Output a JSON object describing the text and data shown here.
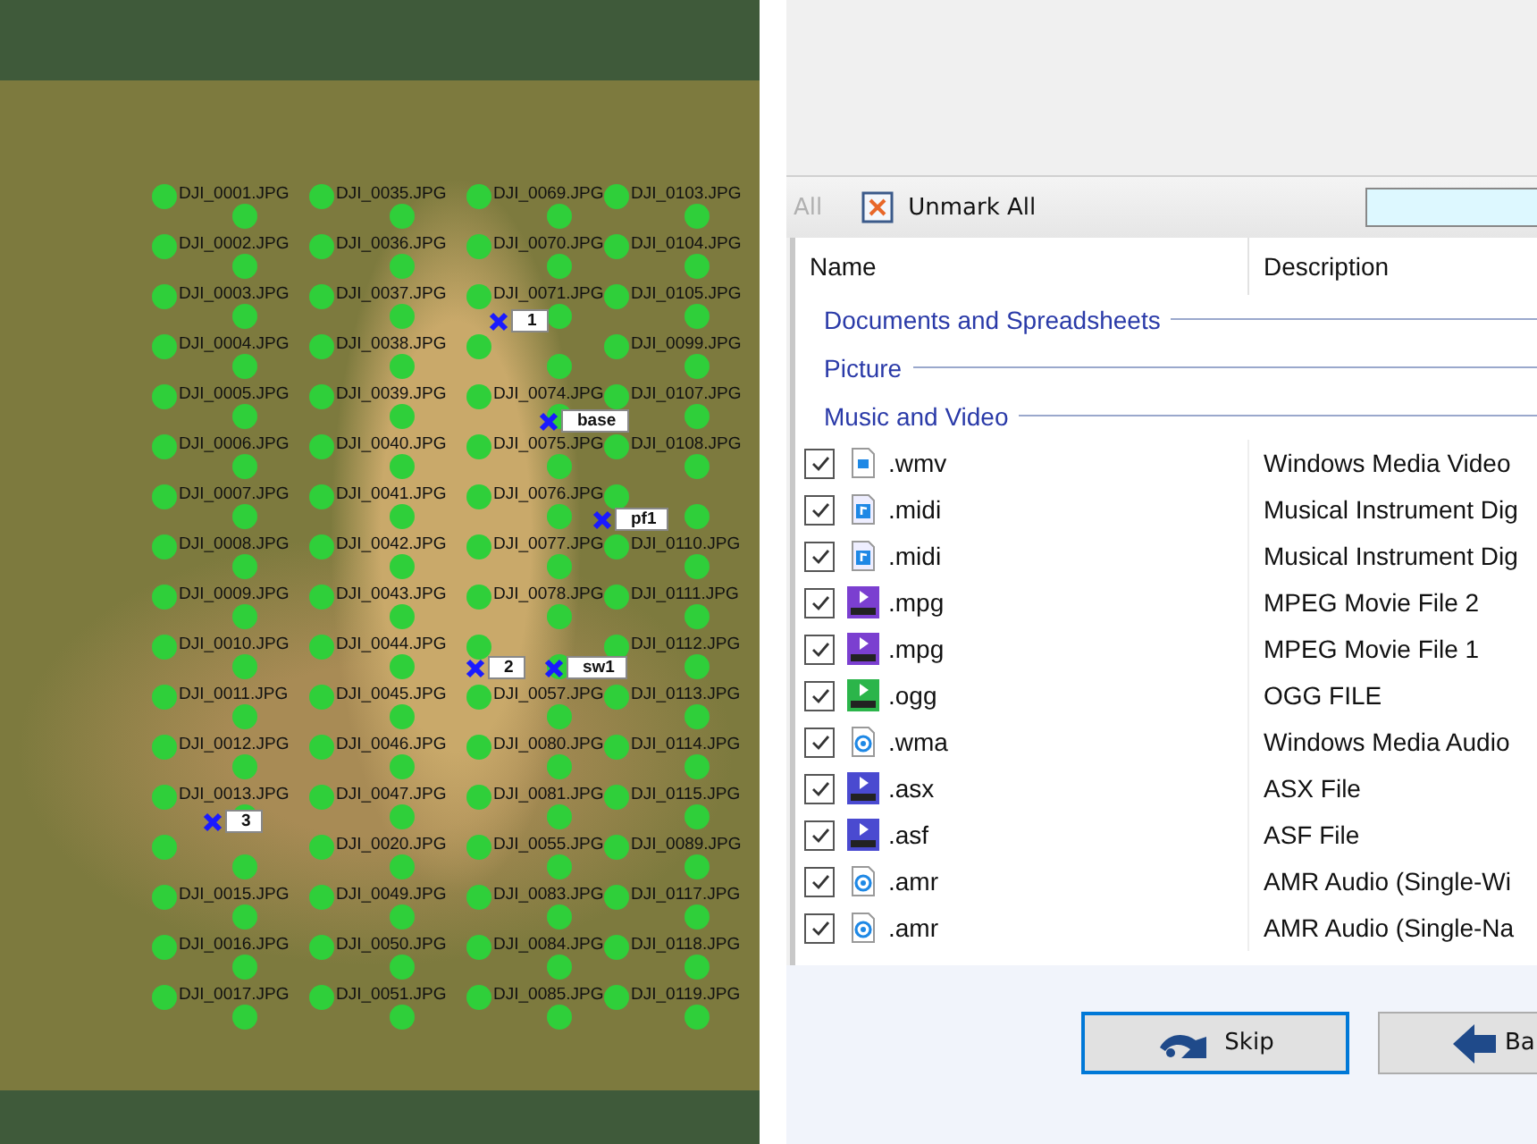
{
  "map": {
    "image_columns": [
      [
        {
          "label": "DJI_0001.JPG"
        },
        {
          "label": "DJI_0002.JPG"
        },
        {
          "label": "DJI_0003.JPG"
        },
        {
          "label": "DJI_0004.JPG"
        },
        {
          "label": "DJI_0005.JPG"
        },
        {
          "label": "DJI_0006.JPG"
        },
        {
          "label": "DJI_0007.JPG"
        },
        {
          "label": "DJI_0008.JPG"
        },
        {
          "label": "DJI_0009.JPG"
        },
        {
          "label": "DJI_0010.JPG"
        },
        {
          "label": "DJI_0011.JPG"
        },
        {
          "label": "DJI_0012.JPG"
        },
        {
          "label": "DJI_0013.JPG"
        },
        {},
        {
          "label": "DJI_0015.JPG"
        },
        {
          "label": "DJI_0016.JPG"
        },
        {
          "label": "DJI_0017.JPG"
        }
      ],
      [
        {
          "label": "DJI_0035.JPG"
        },
        {
          "label": "DJI_0036.JPG"
        },
        {
          "label": "DJI_0037.JPG"
        },
        {
          "label": "DJI_0038.JPG"
        },
        {
          "label": "DJI_0039.JPG"
        },
        {
          "label": "DJI_0040.JPG"
        },
        {
          "label": "DJI_0041.JPG"
        },
        {
          "label": "DJI_0042.JPG"
        },
        {
          "label": "DJI_0043.JPG"
        },
        {
          "label": "DJI_0044.JPG"
        },
        {
          "label": "DJI_0045.JPG"
        },
        {
          "label": "DJI_0046.JPG"
        },
        {
          "label": "DJI_0047.JPG"
        },
        {
          "label": "DJI_0020.JPG"
        },
        {
          "label": "DJI_0049.JPG"
        },
        {
          "label": "DJI_0050.JPG"
        },
        {
          "label": "DJI_0051.JPG"
        }
      ],
      [
        {
          "label": "DJI_0069.JPG"
        },
        {
          "label": "DJI_0070.JPG"
        },
        {
          "label": "DJI_0071.JPG"
        },
        {},
        {
          "label": "DJI_0074.JPG"
        },
        {
          "label": "DJI_0075.JPG"
        },
        {
          "label": "DJI_0076.JPG"
        },
        {
          "label": "DJI_0077.JPG"
        },
        {
          "label": "DJI_0078.JPG"
        },
        {},
        {
          "label": "DJI_0057.JPG"
        },
        {
          "label": "DJI_0080.JPG"
        },
        {
          "label": "DJI_0081.JPG"
        },
        {
          "label": "DJI_0055.JPG"
        },
        {
          "label": "DJI_0083.JPG"
        },
        {
          "label": "DJI_0084.JPG"
        },
        {
          "label": "DJI_0085.JPG"
        }
      ],
      [
        {
          "label": "DJI_0103.JPG"
        },
        {
          "label": "DJI_0104.JPG"
        },
        {
          "label": "DJI_0105.JPG"
        },
        {
          "label": "DJI_0099.JPG"
        },
        {
          "label": "DJI_0107.JPG"
        },
        {
          "label": "DJI_0108.JPG"
        },
        {},
        {
          "label": "DJI_0110.JPG"
        },
        {
          "label": "DJI_0111.JPG"
        },
        {
          "label": "DJI_0112.JPG"
        },
        {
          "label": "DJI_0113.JPG"
        },
        {
          "label": "DJI_0114.JPG"
        },
        {
          "label": "DJI_0115.JPG"
        },
        {
          "label": "DJI_0089.JPG"
        },
        {
          "label": "DJI_0117.JPG"
        },
        {
          "label": "DJI_0118.JPG"
        },
        {
          "label": "DJI_0119.JPG"
        }
      ]
    ],
    "control_points": [
      {
        "label": "1"
      },
      {
        "label": "base"
      },
      {
        "label": "pf1"
      },
      {
        "label": "2"
      },
      {
        "label": "sw1"
      },
      {
        "label": "3"
      }
    ]
  },
  "toolbar": {
    "mark_all": {
      "label": "All",
      "disabled": true
    },
    "unmark_all": {
      "label": "Unmark All"
    }
  },
  "table": {
    "columns": [
      "Name",
      "Description"
    ],
    "groups": [
      {
        "name": "Documents and Spreadsheets"
      },
      {
        "name": "Picture"
      },
      {
        "name": "Music and Video",
        "rows": [
          {
            "checked": true,
            "kind": "page",
            "color": "#1e88e5",
            "name": ".wmv",
            "description": "Windows Media Video"
          },
          {
            "checked": true,
            "kind": "note",
            "color": "#1e88e5",
            "name": ".midi",
            "description": "Musical Instrument Dig"
          },
          {
            "checked": true,
            "kind": "note",
            "color": "#1e88e5",
            "name": ".midi",
            "description": "Musical Instrument Dig"
          },
          {
            "checked": true,
            "kind": "badge",
            "color": "#7b3fd0",
            "name": ".mpg",
            "description": "MPEG Movie File 2"
          },
          {
            "checked": true,
            "kind": "badge",
            "color": "#7b3fd0",
            "name": ".mpg",
            "description": "MPEG Movie File 1"
          },
          {
            "checked": true,
            "kind": "badge",
            "color": "#2bb54a",
            "name": ".ogg",
            "description": "OGG FILE"
          },
          {
            "checked": true,
            "kind": "disc",
            "color": "#1e88e5",
            "name": ".wma",
            "description": "Windows Media Audio"
          },
          {
            "checked": true,
            "kind": "badge",
            "color": "#4a4ad0",
            "name": ".asx",
            "description": "ASX File"
          },
          {
            "checked": true,
            "kind": "badge",
            "color": "#4a4ad0",
            "name": ".asf",
            "description": "ASF File"
          },
          {
            "checked": true,
            "kind": "disc",
            "color": "#1e88e5",
            "name": ".amr",
            "description": "AMR Audio (Single-Wi"
          },
          {
            "checked": true,
            "kind": "disc",
            "color": "#1e88e5",
            "name": ".amr",
            "description": "AMR Audio (Single-Na"
          }
        ]
      }
    ]
  },
  "buttons": [
    {
      "label": "Skip",
      "kind": "skip",
      "focused": true
    },
    {
      "label": "Ba",
      "kind": "back",
      "focused": false
    }
  ]
}
